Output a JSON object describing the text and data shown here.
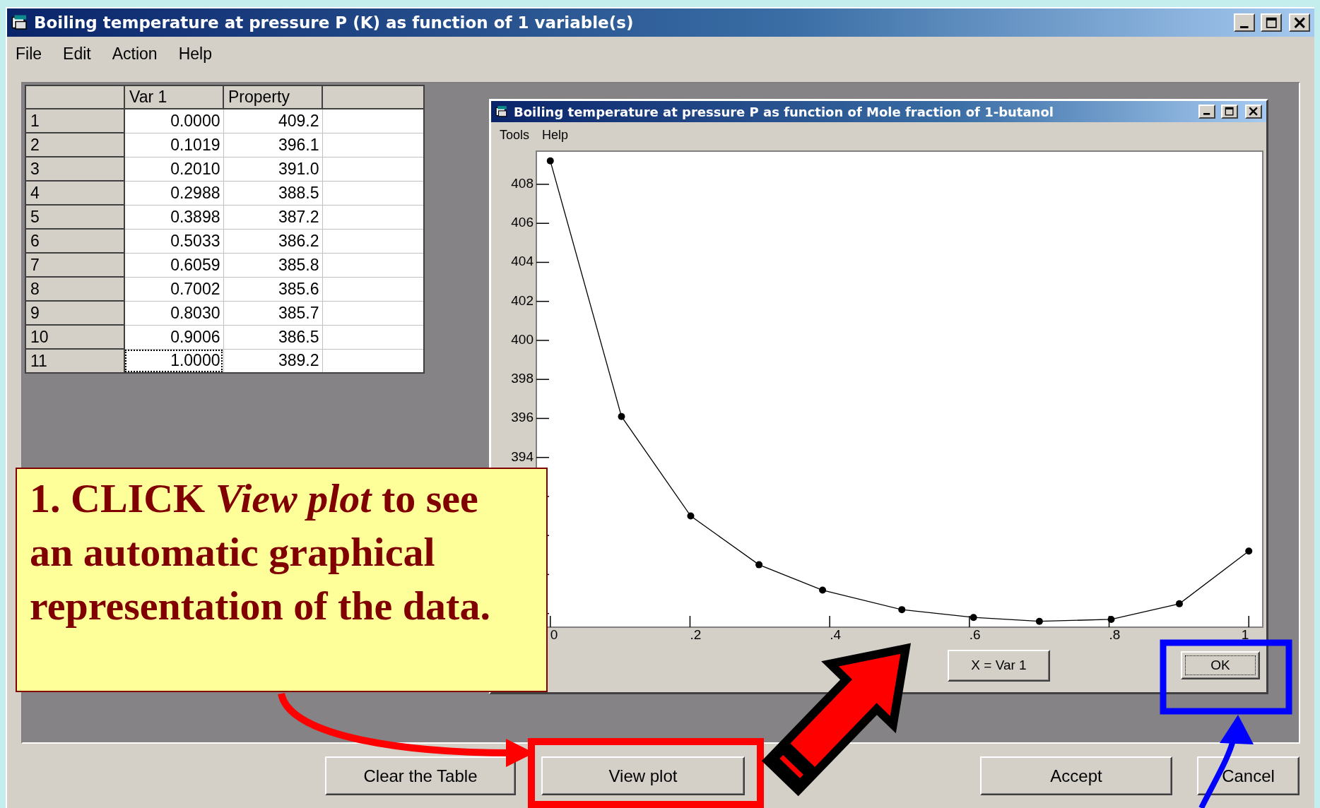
{
  "window": {
    "title": "Boiling temperature at pressure P (K) as function of 1 variable(s)"
  },
  "menu": [
    "File",
    "Edit",
    "Action",
    "Help"
  ],
  "table": {
    "columns": [
      "Var 1",
      "Property"
    ],
    "rows": [
      {
        "label": "1",
        "cells": [
          "0.0000",
          "409.2"
        ],
        "focused": false
      },
      {
        "label": "2",
        "cells": [
          "0.1019",
          "396.1"
        ],
        "focused": false
      },
      {
        "label": "3",
        "cells": [
          "0.2010",
          "391.0"
        ],
        "focused": false
      },
      {
        "label": "4",
        "cells": [
          "0.2988",
          "388.5"
        ],
        "focused": false
      },
      {
        "label": "5",
        "cells": [
          "0.3898",
          "387.2"
        ],
        "focused": false
      },
      {
        "label": "6",
        "cells": [
          "0.5033",
          "386.2"
        ],
        "focused": false
      },
      {
        "label": "7",
        "cells": [
          "0.6059",
          "385.8"
        ],
        "focused": false
      },
      {
        "label": "8",
        "cells": [
          "0.7002",
          "385.6"
        ],
        "focused": false
      },
      {
        "label": "9",
        "cells": [
          "0.8030",
          "385.7"
        ],
        "focused": false
      },
      {
        "label": "10",
        "cells": [
          "0.9006",
          "386.5"
        ],
        "focused": false
      },
      {
        "label": "11",
        "cells": [
          "1.0000",
          "389.2"
        ],
        "focused": true
      }
    ]
  },
  "plot_window": {
    "title": "Boiling temperature at pressure P as function of Mole fraction of 1-butanol",
    "menu": [
      "Tools",
      "Help"
    ],
    "chart_data": {
      "type": "line",
      "x": [
        0,
        0.1019,
        0.201,
        0.2988,
        0.3898,
        0.5033,
        0.6059,
        0.7002,
        0.803,
        0.9006,
        1
      ],
      "series": [
        {
          "marker": "circle",
          "color": "#000000",
          "values": [
            409.2,
            396.1,
            391.0,
            388.5,
            387.2,
            386.2,
            385.8,
            385.6,
            385.7,
            386.5,
            389.2
          ]
        }
      ],
      "xlim": [
        -0.02,
        1.02
      ],
      "ylim": [
        385.3,
        409.7
      ],
      "xticks": [
        {
          "value": 0,
          "label": "0"
        },
        {
          "value": 0.2,
          "label": ".2"
        },
        {
          "value": 0.4,
          "label": ".4"
        },
        {
          "value": 0.6,
          "label": ".6"
        },
        {
          "value": 0.8,
          "label": ".8"
        },
        {
          "value": 1,
          "label": "1"
        }
      ],
      "yticks": [
        394,
        396,
        398,
        400,
        402,
        404,
        406,
        408
      ]
    },
    "buttons": [
      {
        "label": "X = Var 1",
        "default": false
      },
      {
        "label": "OK",
        "default": true
      }
    ]
  },
  "buttons": [
    "Clear the Table",
    "View plot",
    "Accept",
    "Cancel"
  ],
  "callout": {
    "text": "1. CLICK *View plot* to see an automatic graphical representation of the data."
  }
}
